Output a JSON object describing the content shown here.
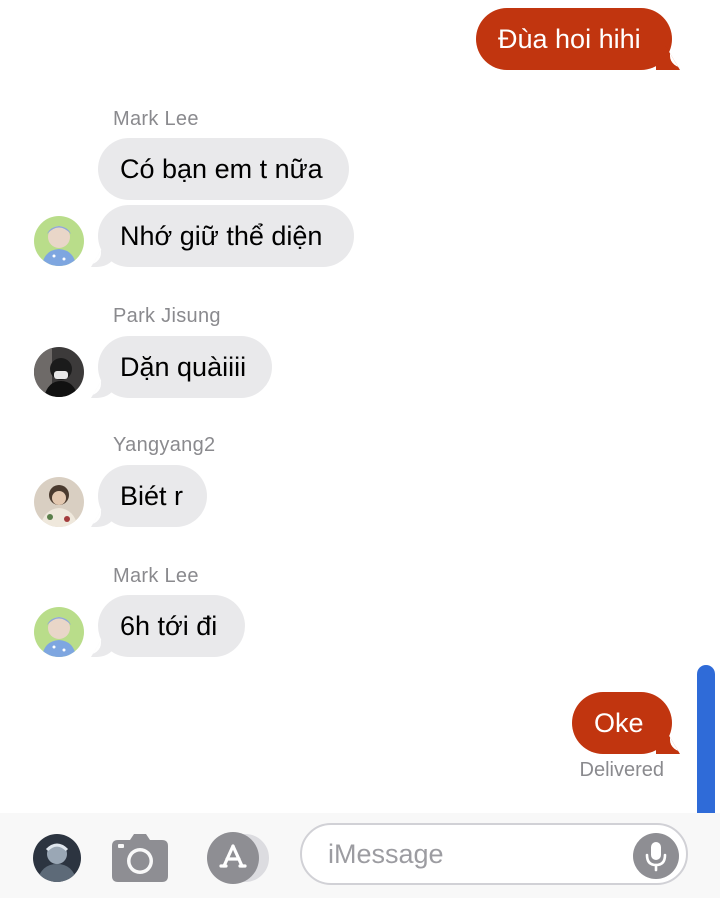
{
  "conversation": {
    "messages": [
      {
        "direction": "outgoing",
        "text": "Đùa hoi hihi"
      },
      {
        "direction": "incoming",
        "sender": "Mark Lee",
        "text": "Có bạn em t nữa"
      },
      {
        "direction": "incoming",
        "text": "Nhớ giữ thể diện"
      },
      {
        "direction": "incoming",
        "sender": "Park Jisung",
        "text": "Dặn quàiiii"
      },
      {
        "direction": "incoming",
        "sender": "Yangyang2",
        "text": "Biét r"
      },
      {
        "direction": "incoming",
        "sender": "Mark Lee",
        "text": "6h tới đi"
      },
      {
        "direction": "outgoing",
        "text": "Oke"
      }
    ],
    "delivery_status": "Delivered"
  },
  "composer": {
    "placeholder": "iMessage",
    "value": ""
  },
  "icons": {
    "camera": "camera-icon",
    "app_store": "app-store-icon",
    "microphone": "microphone-icon"
  },
  "colors": {
    "outgoing_bubble": "#c1350f",
    "incoming_bubble": "#e9e9eb",
    "scrollbar": "#2f6bd8"
  }
}
